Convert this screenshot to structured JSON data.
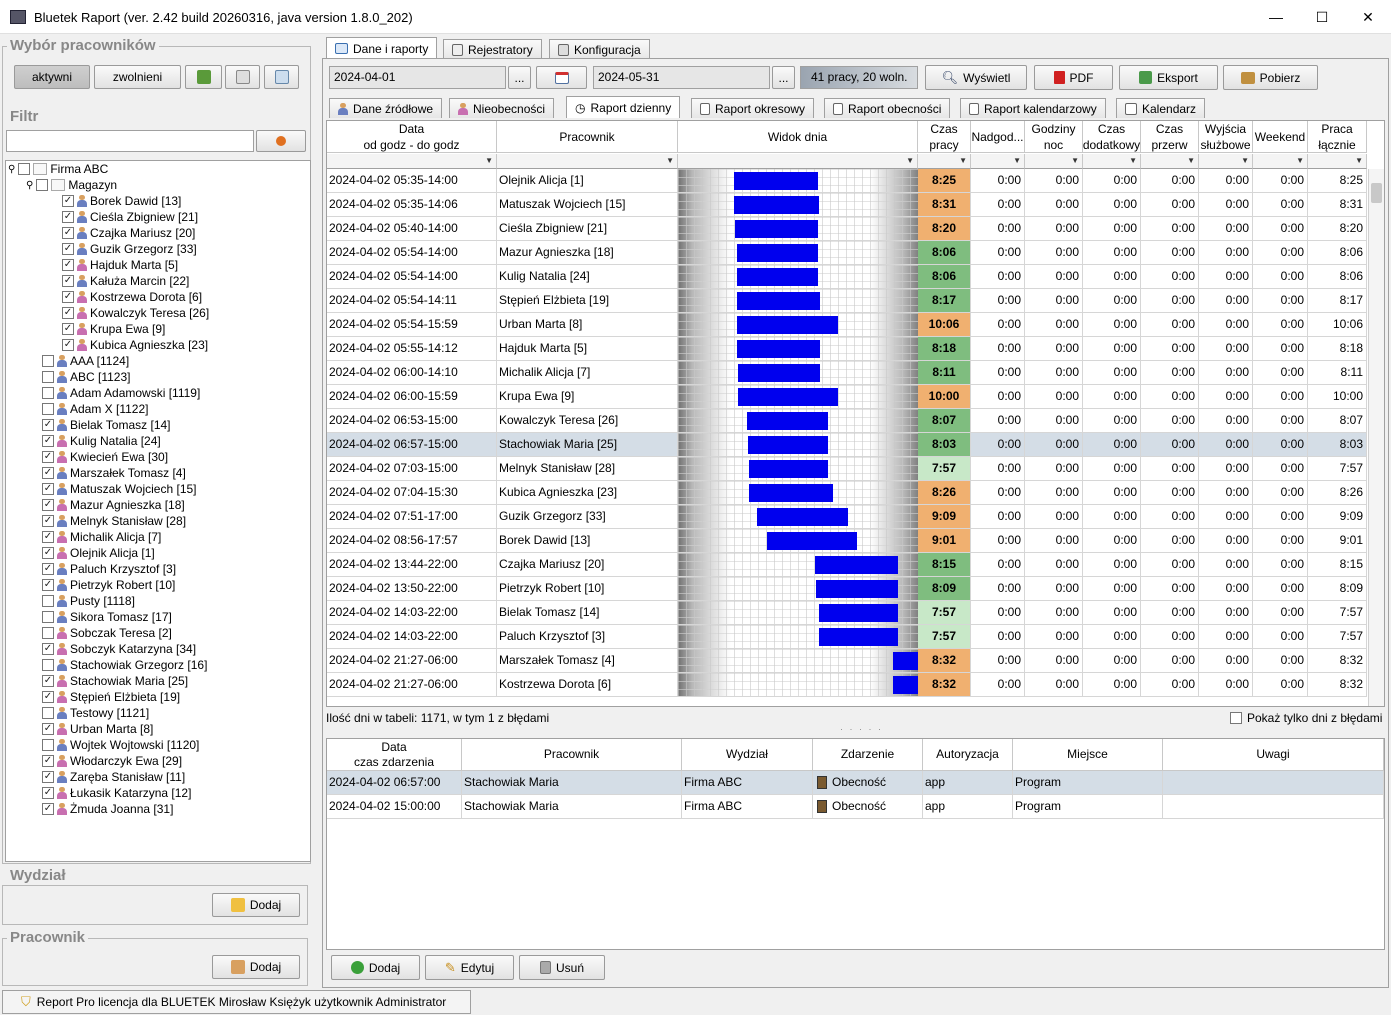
{
  "window": {
    "title": "Bluetek Raport (ver. 2.42 build 20260316, java version 1.8.0_202)",
    "minimize": "—",
    "maximize": "☐",
    "close": "✕"
  },
  "left": {
    "employees_group_title": "Wybór pracowników",
    "btn_active": "aktywni",
    "btn_fired": "zwolnieni",
    "filter_title": "Filtr",
    "filter_value": "",
    "tree": {
      "root": "Firma ABC",
      "group": "Magazyn",
      "group_members": [
        {
          "name": "Borek Dawid [13]",
          "checked": true,
          "f": false
        },
        {
          "name": "Cieśla Zbigniew [21]",
          "checked": true,
          "f": false
        },
        {
          "name": "Czajka Mariusz [20]",
          "checked": true,
          "f": false
        },
        {
          "name": "Guzik Grzegorz [33]",
          "checked": true,
          "f": false
        },
        {
          "name": "Hajduk Marta [5]",
          "checked": true,
          "f": true
        },
        {
          "name": "Kałuża Marcin [22]",
          "checked": true,
          "f": false
        },
        {
          "name": "Kostrzewa Dorota [6]",
          "checked": true,
          "f": true
        },
        {
          "name": "Kowalczyk Teresa [26]",
          "checked": true,
          "f": true
        },
        {
          "name": "Krupa Ewa [9]",
          "checked": true,
          "f": true
        },
        {
          "name": "Kubica Agnieszka [23]",
          "checked": true,
          "f": true
        }
      ],
      "others": [
        {
          "name": "AAA [1124]",
          "checked": false,
          "f": false
        },
        {
          "name": "ABC [1123]",
          "checked": false,
          "f": false
        },
        {
          "name": "Adam Adamowski [1119]",
          "checked": false,
          "f": false
        },
        {
          "name": "Adam X [1122]",
          "checked": false,
          "f": false
        },
        {
          "name": "Bielak Tomasz [14]",
          "checked": true,
          "f": false
        },
        {
          "name": "Kulig Natalia [24]",
          "checked": true,
          "f": true
        },
        {
          "name": "Kwiecień Ewa [30]",
          "checked": true,
          "f": true
        },
        {
          "name": "Marszałek Tomasz [4]",
          "checked": true,
          "f": false
        },
        {
          "name": "Matuszak Wojciech [15]",
          "checked": true,
          "f": false
        },
        {
          "name": "Mazur Agnieszka [18]",
          "checked": true,
          "f": true
        },
        {
          "name": "Melnyk Stanisław [28]",
          "checked": true,
          "f": false
        },
        {
          "name": "Michalik Alicja [7]",
          "checked": true,
          "f": true
        },
        {
          "name": "Olejnik Alicja [1]",
          "checked": true,
          "f": true
        },
        {
          "name": "Paluch Krzysztof [3]",
          "checked": true,
          "f": false
        },
        {
          "name": "Pietrzyk Robert [10]",
          "checked": true,
          "f": false
        },
        {
          "name": "Pusty [1118]",
          "checked": false,
          "f": false
        },
        {
          "name": "Sikora Tomasz [17]",
          "checked": false,
          "f": false
        },
        {
          "name": "Sobczak Teresa [2]",
          "checked": false,
          "f": true
        },
        {
          "name": "Sobczyk Katarzyna [34]",
          "checked": true,
          "f": true
        },
        {
          "name": "Stachowiak Grzegorz [16]",
          "checked": false,
          "f": false
        },
        {
          "name": "Stachowiak Maria [25]",
          "checked": true,
          "f": true
        },
        {
          "name": "Stępień Elżbieta [19]",
          "checked": true,
          "f": true
        },
        {
          "name": "Testowy [1121]",
          "checked": false,
          "f": false
        },
        {
          "name": "Urban Marta [8]",
          "checked": true,
          "f": true
        },
        {
          "name": "Wojtek Wojtowski [1120]",
          "checked": false,
          "f": false
        },
        {
          "name": "Włodarczyk Ewa [29]",
          "checked": true,
          "f": true
        },
        {
          "name": "Zaręba Stanisław [11]",
          "checked": true,
          "f": false
        },
        {
          "name": "Łukasik Katarzyna [12]",
          "checked": true,
          "f": true
        },
        {
          "name": "Żmuda Joanna [31]",
          "checked": true,
          "f": true
        }
      ]
    },
    "dept_title": "Wydział",
    "dept_add": "Dodaj",
    "emp_title": "Pracownik",
    "emp_add": "Dodaj"
  },
  "top_tabs": [
    "Dane i raporty",
    "Rejestratory",
    "Konfiguracja"
  ],
  "toolbar": {
    "date_from": "2024-04-01",
    "date_to": "2024-05-31",
    "dots": "...",
    "info": "41 pracy, 20 woln.",
    "show": "Wyświetl",
    "pdf": "PDF",
    "export": "Eksport",
    "download": "Pobierz"
  },
  "sub_tabs": [
    "Dane źródłowe",
    "Nieobecności",
    "Raport dzienny",
    "Raport okresowy",
    "Raport obecności",
    "Raport kalendarzowy",
    "Kalendarz"
  ],
  "table": {
    "headers": {
      "date": "Data",
      "date2": "od godz - do godz",
      "employee": "Pracownik",
      "dayview": "Widok dnia",
      "worktime": "Czas",
      "worktime2": "pracy",
      "overtime": "Nadgod...",
      "night": "Godziny",
      "night2": "noc",
      "extra": "Czas",
      "extra2": "dodatkowy",
      "breaks": "Czas",
      "breaks2": "przerw",
      "business": "Wyjścia",
      "business2": "służbowe",
      "weekend": "Weekend",
      "total": "Praca",
      "total2": "łącznie"
    },
    "rows": [
      {
        "date": "2024-04-02  05:35-14:00",
        "emp": "Olejnik Alicja [1]",
        "start": 5.58,
        "end": 14.0,
        "work": "8:25",
        "status": "orange",
        "o": "0:00",
        "n": "0:00",
        "x": "0:00",
        "p": "0:00",
        "w": "0:00",
        "we": "0:00",
        "total": "8:25"
      },
      {
        "date": "2024-04-02  05:35-14:06",
        "emp": "Matuszak Wojciech [15]",
        "start": 5.58,
        "end": 14.1,
        "work": "8:31",
        "status": "orange",
        "o": "0:00",
        "n": "0:00",
        "x": "0:00",
        "p": "0:00",
        "w": "0:00",
        "we": "0:00",
        "total": "8:31"
      },
      {
        "date": "2024-04-02  05:40-14:00",
        "emp": "Cieśla Zbigniew [21]",
        "start": 5.67,
        "end": 14.0,
        "work": "8:20",
        "status": "orange",
        "o": "0:00",
        "n": "0:00",
        "x": "0:00",
        "p": "0:00",
        "w": "0:00",
        "we": "0:00",
        "total": "8:20"
      },
      {
        "date": "2024-04-02  05:54-14:00",
        "emp": "Mazur Agnieszka [18]",
        "start": 5.9,
        "end": 14.0,
        "work": "8:06",
        "status": "green",
        "o": "0:00",
        "n": "0:00",
        "x": "0:00",
        "p": "0:00",
        "w": "0:00",
        "we": "0:00",
        "total": "8:06"
      },
      {
        "date": "2024-04-02  05:54-14:00",
        "emp": "Kulig Natalia [24]",
        "start": 5.9,
        "end": 14.0,
        "work": "8:06",
        "status": "green",
        "o": "0:00",
        "n": "0:00",
        "x": "0:00",
        "p": "0:00",
        "w": "0:00",
        "we": "0:00",
        "total": "8:06"
      },
      {
        "date": "2024-04-02  05:54-14:11",
        "emp": "Stępień Elżbieta [19]",
        "start": 5.9,
        "end": 14.18,
        "work": "8:17",
        "status": "green",
        "o": "0:00",
        "n": "0:00",
        "x": "0:00",
        "p": "0:00",
        "w": "0:00",
        "we": "0:00",
        "total": "8:17"
      },
      {
        "date": "2024-04-02  05:54-15:59",
        "emp": "Urban Marta [8]",
        "start": 5.9,
        "end": 15.98,
        "work": "10:06",
        "status": "orange",
        "o": "0:00",
        "n": "0:00",
        "x": "0:00",
        "p": "0:00",
        "w": "0:00",
        "we": "0:00",
        "total": "10:06"
      },
      {
        "date": "2024-04-02  05:55-14:12",
        "emp": "Hajduk Marta [5]",
        "start": 5.92,
        "end": 14.2,
        "work": "8:18",
        "status": "green",
        "o": "0:00",
        "n": "0:00",
        "x": "0:00",
        "p": "0:00",
        "w": "0:00",
        "we": "0:00",
        "total": "8:18"
      },
      {
        "date": "2024-04-02  06:00-14:10",
        "emp": "Michalik Alicja [7]",
        "start": 6.0,
        "end": 14.17,
        "work": "8:11",
        "status": "green",
        "o": "0:00",
        "n": "0:00",
        "x": "0:00",
        "p": "0:00",
        "w": "0:00",
        "we": "0:00",
        "total": "8:11"
      },
      {
        "date": "2024-04-02  06:00-15:59",
        "emp": "Krupa Ewa [9]",
        "start": 6.0,
        "end": 15.98,
        "work": "10:00",
        "status": "orange",
        "o": "0:00",
        "n": "0:00",
        "x": "0:00",
        "p": "0:00",
        "w": "0:00",
        "we": "0:00",
        "total": "10:00"
      },
      {
        "date": "2024-04-02  06:53-15:00",
        "emp": "Kowalczyk Teresa [26]",
        "start": 6.88,
        "end": 15.0,
        "work": "8:07",
        "status": "green",
        "o": "0:00",
        "n": "0:00",
        "x": "0:00",
        "p": "0:00",
        "w": "0:00",
        "we": "0:00",
        "total": "8:07"
      },
      {
        "date": "2024-04-02  06:57-15:00",
        "emp": "Stachowiak Maria [25]",
        "start": 6.95,
        "end": 15.0,
        "work": "8:03",
        "status": "green",
        "o": "0:00",
        "n": "0:00",
        "x": "0:00",
        "p": "0:00",
        "w": "0:00",
        "we": "0:00",
        "total": "8:03",
        "selected": true
      },
      {
        "date": "2024-04-02  07:03-15:00",
        "emp": "Melnyk Stanisław [28]",
        "start": 7.05,
        "end": 15.0,
        "work": "7:57",
        "status": "lightgreen",
        "o": "0:00",
        "n": "0:00",
        "x": "0:00",
        "p": "0:00",
        "w": "0:00",
        "we": "0:00",
        "total": "7:57"
      },
      {
        "date": "2024-04-02  07:04-15:30",
        "emp": "Kubica Agnieszka [23]",
        "start": 7.07,
        "end": 15.5,
        "work": "8:26",
        "status": "orange",
        "o": "0:00",
        "n": "0:00",
        "x": "0:00",
        "p": "0:00",
        "w": "0:00",
        "we": "0:00",
        "total": "8:26"
      },
      {
        "date": "2024-04-02  07:51-17:00",
        "emp": "Guzik Grzegorz [33]",
        "start": 7.85,
        "end": 17.0,
        "work": "9:09",
        "status": "orange",
        "o": "0:00",
        "n": "0:00",
        "x": "0:00",
        "p": "0:00",
        "w": "0:00",
        "we": "0:00",
        "total": "9:09"
      },
      {
        "date": "2024-04-02  08:56-17:57",
        "emp": "Borek Dawid [13]",
        "start": 8.93,
        "end": 17.95,
        "work": "9:01",
        "status": "orange",
        "o": "0:00",
        "n": "0:00",
        "x": "0:00",
        "p": "0:00",
        "w": "0:00",
        "we": "0:00",
        "total": "9:01"
      },
      {
        "date": "2024-04-02  13:44-22:00",
        "emp": "Czajka Mariusz [20]",
        "start": 13.73,
        "end": 22.0,
        "work": "8:15",
        "status": "green",
        "o": "0:00",
        "n": "0:00",
        "x": "0:00",
        "p": "0:00",
        "w": "0:00",
        "we": "0:00",
        "total": "8:15"
      },
      {
        "date": "2024-04-02  13:50-22:00",
        "emp": "Pietrzyk Robert [10]",
        "start": 13.83,
        "end": 22.0,
        "work": "8:09",
        "status": "green",
        "o": "0:00",
        "n": "0:00",
        "x": "0:00",
        "p": "0:00",
        "w": "0:00",
        "we": "0:00",
        "total": "8:09"
      },
      {
        "date": "2024-04-02  14:03-22:00",
        "emp": "Bielak Tomasz [14]",
        "start": 14.05,
        "end": 22.0,
        "work": "7:57",
        "status": "lightgreen",
        "o": "0:00",
        "n": "0:00",
        "x": "0:00",
        "p": "0:00",
        "w": "0:00",
        "we": "0:00",
        "total": "7:57"
      },
      {
        "date": "2024-04-02  14:03-22:00",
        "emp": "Paluch Krzysztof [3]",
        "start": 14.05,
        "end": 22.0,
        "work": "7:57",
        "status": "lightgreen",
        "o": "0:00",
        "n": "0:00",
        "x": "0:00",
        "p": "0:00",
        "w": "0:00",
        "we": "0:00",
        "total": "7:57"
      },
      {
        "date": "2024-04-02  21:27-06:00",
        "emp": "Marszałek Tomasz [4]",
        "start": 21.45,
        "end": 24.0,
        "work": "8:32",
        "status": "orange",
        "o": "0:00",
        "n": "0:00",
        "x": "0:00",
        "p": "0:00",
        "w": "0:00",
        "we": "0:00",
        "total": "8:32"
      },
      {
        "date": "2024-04-02  21:27-06:00",
        "emp": "Kostrzewa Dorota [6]",
        "start": 21.45,
        "end": 24.0,
        "work": "8:32",
        "status": "orange",
        "o": "0:00",
        "n": "0:00",
        "x": "0:00",
        "p": "0:00",
        "w": "0:00",
        "we": "0:00",
        "total": "8:32"
      }
    ],
    "footer": "Ilość dni w tabeli: 1171, w tym 1 z błędami",
    "errors_only": "Pokaż tylko dni z błędami"
  },
  "lower": {
    "headers": {
      "date": "Data",
      "date2": "czas zdarzenia",
      "employee": "Pracownik",
      "dept": "Wydział",
      "event": "Zdarzenie",
      "auth": "Autoryzacja",
      "place": "Miejsce",
      "notes": "Uwagi"
    },
    "rows": [
      {
        "date": "2024-04-02 06:57:00",
        "emp": "Stachowiak Maria",
        "dept": "Firma ABC",
        "event": "Obecność",
        "auth": "app",
        "place": "Program",
        "notes": "",
        "selected": true
      },
      {
        "date": "2024-04-02 15:00:00",
        "emp": "Stachowiak Maria",
        "dept": "Firma ABC",
        "event": "Obecność",
        "auth": "app",
        "place": "Program",
        "notes": ""
      }
    ],
    "add": "Dodaj",
    "edit": "Edytuj",
    "delete": "Usuń"
  },
  "statusbar": "Report Pro licencja dla BLUETEK Mirosław Księżyk użytkownik Administrator",
  "colors": {
    "orange": "#f0b070",
    "green": "#7fbd7f",
    "lightgreen": "#c8e8c8",
    "bar": "#0000ee",
    "selected": "#d4dde6"
  }
}
